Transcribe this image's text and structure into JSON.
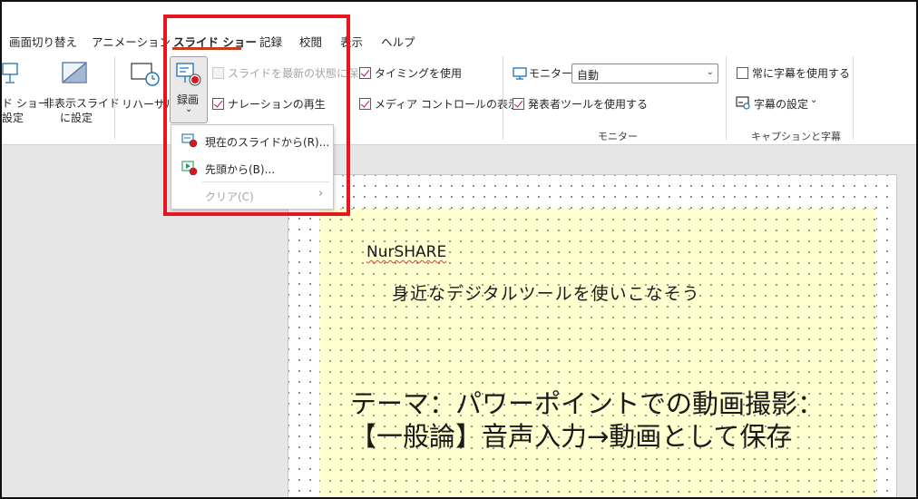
{
  "ribbon_tabs": [
    {
      "label": "画面切り替え"
    },
    {
      "label": "アニメーション"
    },
    {
      "label": "スライド ショー"
    },
    {
      "label": "記録"
    },
    {
      "label": "校閲"
    },
    {
      "label": "表示"
    },
    {
      "label": "ヘルプ"
    }
  ],
  "setup": {
    "slideshow_settings": "ド ショー\n設定",
    "hide_slide": "非表示スライド\nに設定",
    "rehearse": "リハーサル",
    "record": "録画"
  },
  "checks": {
    "keep_updated": {
      "label": "スライドを最新の状態に保つ",
      "checked": false,
      "disabled": true
    },
    "play_narration": {
      "label": "ナレーションの再生",
      "checked": true
    },
    "use_timings": {
      "label": "タイミングを使用",
      "checked": true
    },
    "show_media_controls": {
      "label": "メディア コントロールの表示",
      "checked": true
    },
    "use_presenter_view": {
      "label": "発表者ツールを使用する",
      "checked": true
    },
    "always_subtitles": {
      "label": "常に字幕を使用する",
      "checked": false
    }
  },
  "monitor": {
    "label": "モニター:",
    "value": "自動",
    "group_label": "モニター"
  },
  "captions": {
    "settings_label": "字幕の設定",
    "group_label": "キャプションと字幕"
  },
  "record_menu": [
    {
      "label": "現在のスライドから(R)..."
    },
    {
      "label": "先頭から(B)..."
    },
    {
      "label": "クリア(C)",
      "disabled": true,
      "submenu": true
    }
  ],
  "slide": {
    "author": "NurSHARE",
    "subtitle": "身近なデジタルツールを使いこなそう",
    "title_line1": "テーマ：パワーポイントでの動画撮影：",
    "title_line2": "【一般論】音声入力→動画として保存"
  },
  "colors": {
    "accent": "#c43e1c",
    "highlight": "#e8141e",
    "slide_bg": "#ffffd0"
  }
}
